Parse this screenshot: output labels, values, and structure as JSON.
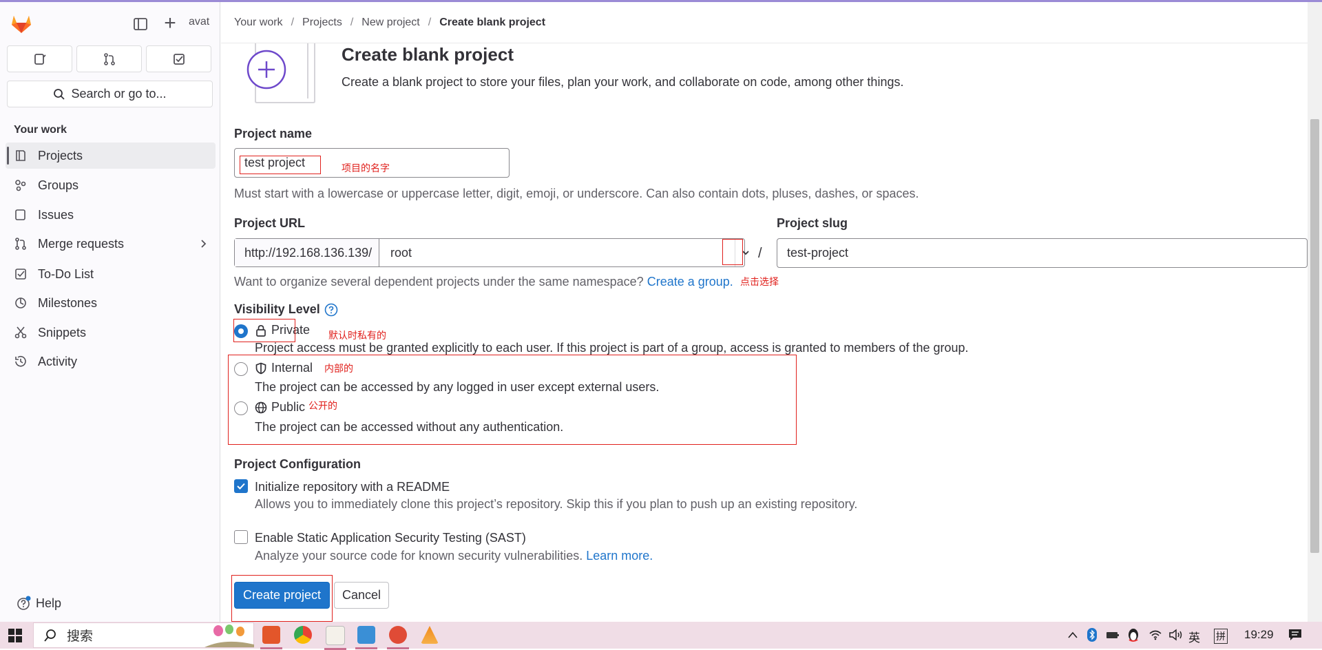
{
  "sidebar": {
    "user_short": "avat",
    "search_label": "Search or go to...",
    "section_title": "Your work",
    "items": [
      {
        "label": "Projects",
        "icon": "project-icon"
      },
      {
        "label": "Groups",
        "icon": "group-icon"
      },
      {
        "label": "Issues",
        "icon": "issues-icon"
      },
      {
        "label": "Merge requests",
        "icon": "merge-request-icon"
      },
      {
        "label": "To-Do List",
        "icon": "todo-icon"
      },
      {
        "label": "Milestones",
        "icon": "milestone-icon"
      },
      {
        "label": "Snippets",
        "icon": "snippet-icon"
      },
      {
        "label": "Activity",
        "icon": "history-icon"
      }
    ],
    "help_label": "Help"
  },
  "breadcrumb": [
    "Your work",
    "Projects",
    "New project",
    "Create blank project"
  ],
  "page": {
    "title": "Create blank project",
    "description": "Create a blank project to store your files, plan your work, and collaborate on code, among other things."
  },
  "form": {
    "project_name_label": "Project name",
    "project_name_value": "test project",
    "project_name_note": "项目的名字",
    "project_name_help": "Must start with a lowercase or uppercase letter, digit, emoji, or underscore. Can also contain dots, pluses, dashes, or spaces.",
    "project_url_label": "Project URL",
    "project_url_prefix": "http://192.168.136.139/",
    "project_url_namespace": "root",
    "slash": "/",
    "project_slug_label": "Project slug",
    "project_slug_value": "test-project",
    "group_help": "Want to organize several dependent projects under the same namespace?",
    "group_link": "Create a group.",
    "dropdown_note": "点击选择",
    "visibility_label": "Visibility Level",
    "visibility": [
      {
        "label": "Private",
        "desc": "Project access must be granted explicitly to each user. If this project is part of a group, access is granted to members of the group.",
        "note": "默认时私有的",
        "checked": true
      },
      {
        "label": "Internal",
        "desc": "The project can be accessed by any logged in user except external users.",
        "note": "内部的",
        "checked": false
      },
      {
        "label": "Public",
        "desc": "The project can be accessed without any authentication.",
        "note": "公开的",
        "checked": false
      }
    ],
    "config_label": "Project Configuration",
    "readme_label": "Initialize repository with a README",
    "readme_desc": "Allows you to immediately clone this project’s repository. Skip this if you plan to push up an existing repository.",
    "readme_checked": true,
    "sast_label": "Enable Static Application Security Testing (SAST)",
    "sast_desc": "Analyze your source code for known security vulnerabilities.",
    "sast_link": "Learn more.",
    "sast_checked": false,
    "create_button": "Create project",
    "cancel_button": "Cancel"
  },
  "taskbar": {
    "search_placeholder": "搜索",
    "ime_lang": "英",
    "ime_mode": "拼",
    "clock": "19:29"
  },
  "colors": {
    "accent": "#1f75cb",
    "annotation_red": "#e0201c",
    "gitlab_orange": "#fc6d26",
    "illustration_purple": "#6e49cb"
  }
}
